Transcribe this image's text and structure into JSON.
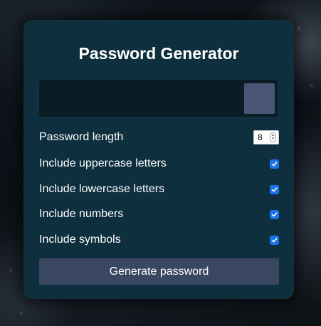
{
  "app": {
    "title": "Password Generator"
  },
  "result": {
    "value": "",
    "copy_button_label": ""
  },
  "options": {
    "length": {
      "label": "Password length",
      "value": "8"
    },
    "uppercase": {
      "label": "Include uppercase letters",
      "checked": true
    },
    "lowercase": {
      "label": "Include lowercase letters",
      "checked": true
    },
    "numbers": {
      "label": "Include numbers",
      "checked": true
    },
    "symbols": {
      "label": "Include symbols",
      "checked": true
    }
  },
  "actions": {
    "generate_label": "Generate password"
  },
  "colors": {
    "card_bg": "#0e2f3e",
    "result_bg": "#0a1d24",
    "copy_button": "#4a5474",
    "generate_button": "#3a4763",
    "checkbox_accent": "#1a73e8",
    "text": "#ffffff"
  },
  "icons": {
    "checkbox": "checkmark-icon",
    "stepper": "stepper-arrows-icon"
  }
}
